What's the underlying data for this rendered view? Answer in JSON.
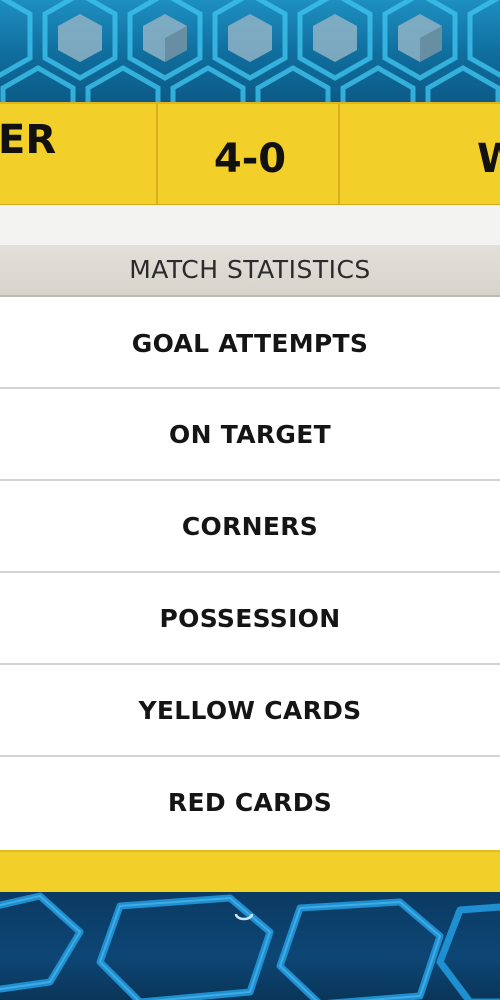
{
  "scoreboard": {
    "team_left_partial": "ER",
    "score": "4-0",
    "team_right_partial": "W"
  },
  "stats": {
    "header": "MATCH STATISTICS",
    "rows": [
      {
        "label": "GOAL ATTEMPTS"
      },
      {
        "label": "ON TARGET"
      },
      {
        "label": "CORNERS"
      },
      {
        "label": "POSSESSION"
      },
      {
        "label": "YELLOW CARDS"
      },
      {
        "label": "RED CARDS"
      }
    ]
  },
  "colors": {
    "scoreboard_yellow": "#f3cf2a",
    "header_grey": "#d9d7cf",
    "background_blue": "#1d8fc0",
    "row_white": "#ffffff"
  }
}
